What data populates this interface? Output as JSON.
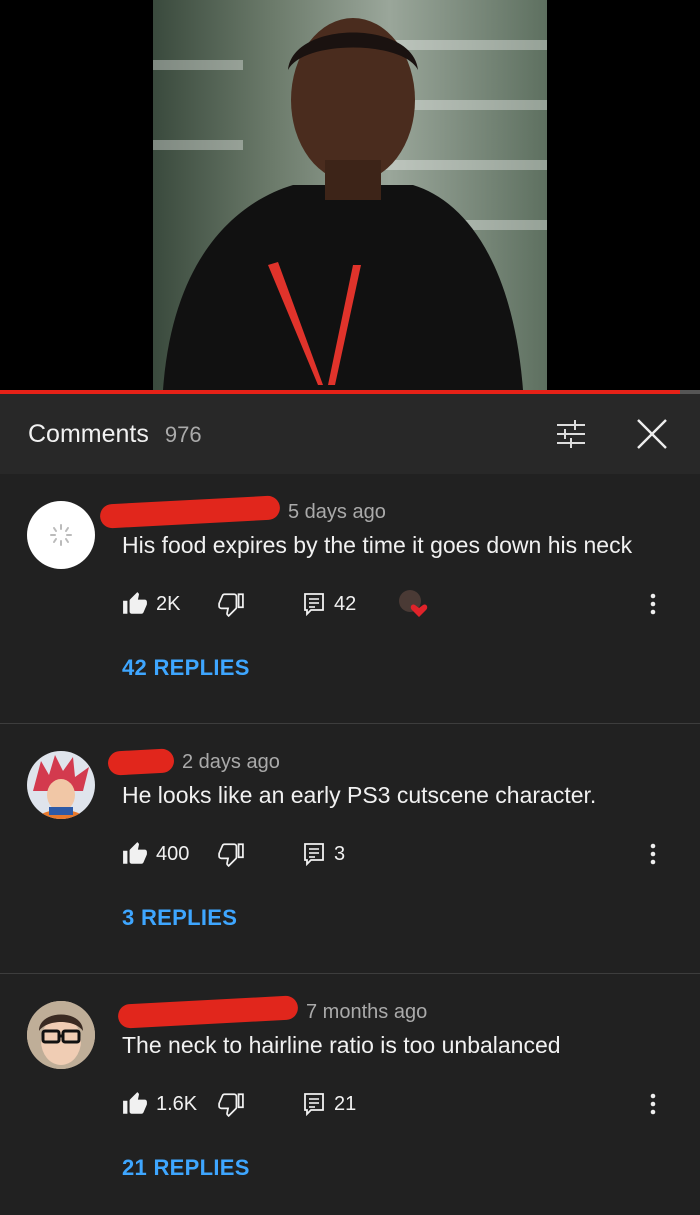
{
  "video": {
    "progress_fraction": 0.97
  },
  "header": {
    "title": "Comments",
    "count": "976"
  },
  "comments": [
    {
      "time": "5 days ago",
      "text": "His food expires by the time it goes down his neck",
      "likes": "2K",
      "reply_count": "42",
      "replies_label": "42 REPLIES",
      "avatar": "loading-avatar",
      "creator_heart": true
    },
    {
      "time": "2 days ago",
      "text": "He looks like an early PS3 cutscene character.",
      "likes": "400",
      "reply_count": "3",
      "replies_label": "3 REPLIES",
      "avatar": "anime-avatar",
      "creator_heart": false
    },
    {
      "time": "7 months ago",
      "text": "The neck to hairline ratio is too unbalanced",
      "likes": "1.6K",
      "reply_count": "21",
      "replies_label": "21 REPLIES",
      "avatar": "person-avatar",
      "creator_heart": false
    }
  ],
  "colors": {
    "background": "#212121",
    "header": "#282828",
    "accent_link": "#3ea6ff",
    "progress": "#e62117",
    "redaction": "#e1261c"
  },
  "icons": [
    "filter-icon",
    "close-icon",
    "like-icon",
    "dislike-icon",
    "reply-icon",
    "more-options-icon",
    "creator-heart-icon"
  ]
}
